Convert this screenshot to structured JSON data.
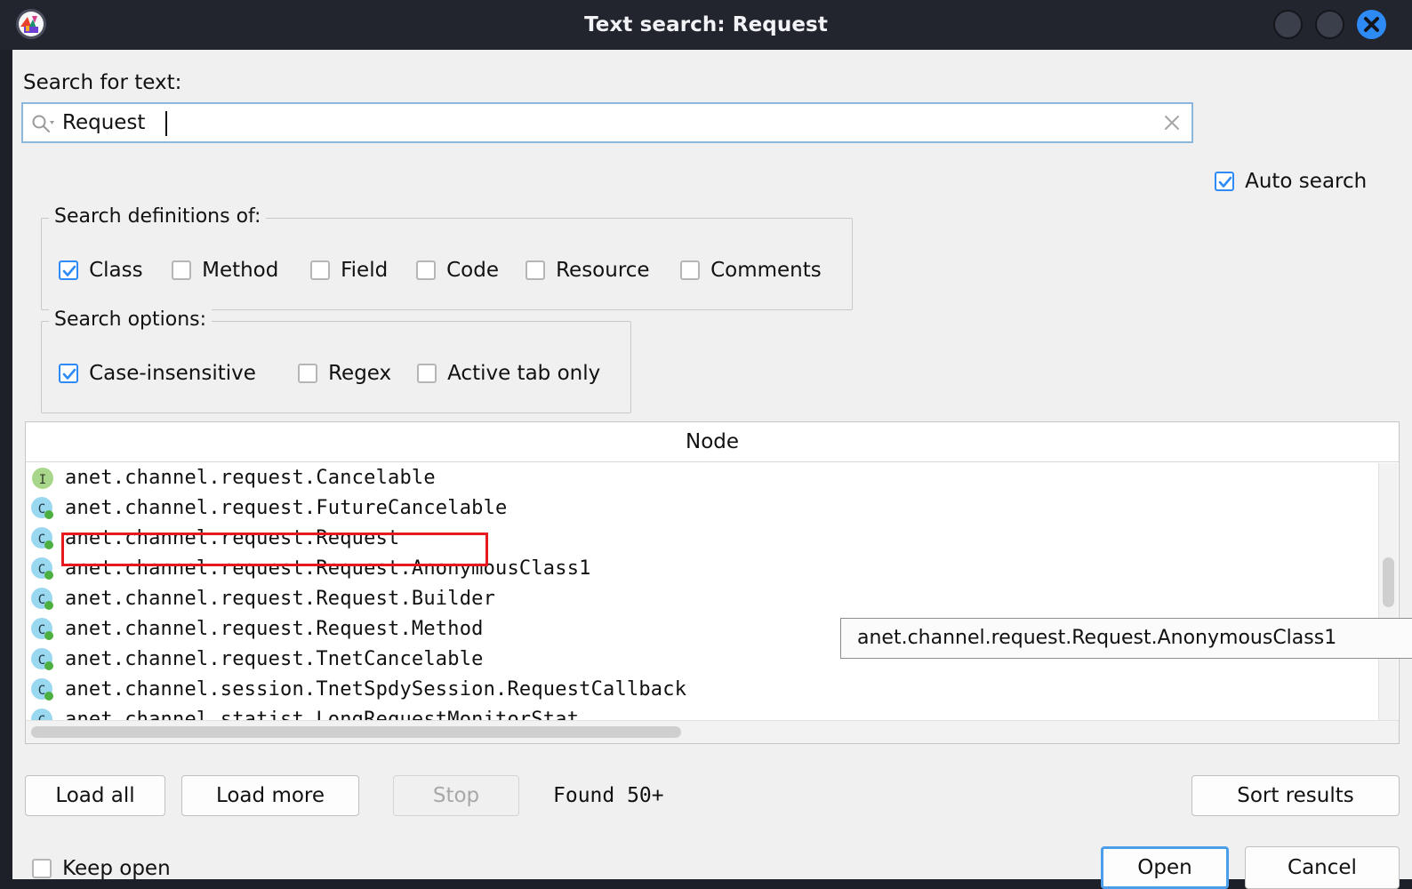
{
  "window": {
    "title": "Text search: Request",
    "app_icon": "app-logo-icon",
    "controls": {
      "minimize": "minimize-button",
      "maximize": "maximize-button",
      "close": "close-button"
    },
    "accent_blue": "#2e8bf5",
    "titlebar_bg": "#22242e",
    "dialog_bg": "#f0f0f0",
    "annotation_color": "#e8181f"
  },
  "search": {
    "label": "Search for text:",
    "value": "Request",
    "placeholder": "",
    "icon": "search-icon",
    "clear_icon": "clear-icon",
    "auto_search": {
      "label": "Auto search",
      "checked": true
    }
  },
  "definitions_group": {
    "title": "Search definitions of:",
    "items": [
      {
        "label": "Class",
        "checked": true
      },
      {
        "label": "Method",
        "checked": false
      },
      {
        "label": "Field",
        "checked": false
      },
      {
        "label": "Code",
        "checked": false
      },
      {
        "label": "Resource",
        "checked": false
      },
      {
        "label": "Comments",
        "checked": false
      }
    ]
  },
  "options_group": {
    "title": "Search options:",
    "items": [
      {
        "label": "Case-insensitive",
        "checked": true
      },
      {
        "label": "Regex",
        "checked": false
      },
      {
        "label": "Active tab only",
        "checked": false
      }
    ]
  },
  "results": {
    "column_header": "Node",
    "rows": [
      {
        "icon": "interface-icon",
        "label": "anet.channel.request.Cancelable"
      },
      {
        "icon": "class-icon",
        "label": "anet.channel.request.FutureCancelable"
      },
      {
        "icon": "class-icon",
        "label": "anet.channel.request.Request"
      },
      {
        "icon": "class-icon",
        "label": "anet.channel.request.Request.AnonymousClass1"
      },
      {
        "icon": "class-icon",
        "label": "anet.channel.request.Request.Builder"
      },
      {
        "icon": "class-icon",
        "label": "anet.channel.request.Request.Method"
      },
      {
        "icon": "class-icon",
        "label": "anet.channel.request.TnetCancelable"
      },
      {
        "icon": "class-icon",
        "label": "anet.channel.session.TnetSpdySession.RequestCallback"
      },
      {
        "icon": "class-icon",
        "label": "anet.channel.statist.LongRequestMonitorStat"
      }
    ],
    "highlighted_row_index": 2,
    "tooltip": "anet.channel.request.Request.AnonymousClass1"
  },
  "toolbar": {
    "load_all_label": "Load all",
    "load_more_label": "Load more",
    "stop_label": "Stop",
    "stop_enabled": false,
    "found_label": "Found  50+",
    "sort_results_label": "Sort results"
  },
  "footer": {
    "keep_open": {
      "label": "Keep open",
      "checked": false
    },
    "open_label": "Open",
    "cancel_label": "Cancel"
  }
}
